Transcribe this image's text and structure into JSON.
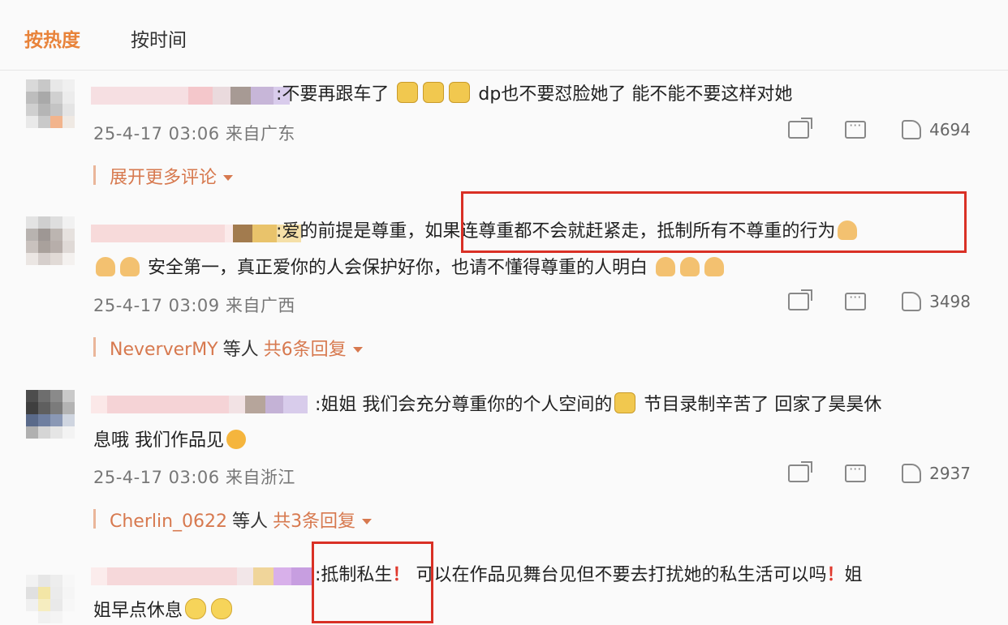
{
  "tabs": {
    "hot": "按热度",
    "time": "按时间"
  },
  "comments": [
    {
      "text_a": ":不要再跟车了",
      "text_b": "dp也不要怼脸她了 能不能不要这样对她",
      "time": "25-4-17 03:06 来自广东",
      "likes": "4694",
      "expand": "展开更多评论"
    },
    {
      "text_a": ":爱的前提是尊重，",
      "text_b": "如果连尊重都不会就赶紧走，抵制所有不尊重的行为",
      "line2": "安全第一，真正爱你的人会保护好你，也请不懂得尊重的人明白",
      "time": "25-4-17 03:09 来自广西",
      "likes": "3498",
      "reply_user": "NeververMY",
      "reply_mid": "等人",
      "reply_count": "共6条回复"
    },
    {
      "text_a": ":姐姐 我们会充分尊重你的个人空间的",
      "text_b": "节目录制辛苦了 回家了昊昊休",
      "line2": "息哦 我们作品见",
      "time": "25-4-17 03:06 来自浙江",
      "likes": "2937",
      "reply_user": "Cherlin_0622",
      "reply_mid": "等人",
      "reply_count": "共3条回复"
    },
    {
      "text_a": ":抵制私生",
      "excl": "！",
      "text_b": "可以在作品见舞台见但不要去打扰她的私生活可以吗",
      "text_c": "姐",
      "line2": "姐早点休息"
    }
  ]
}
